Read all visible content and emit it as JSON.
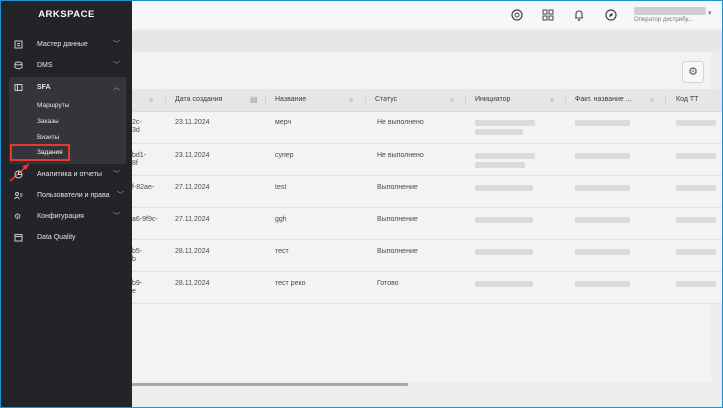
{
  "app": {
    "logo": "ARKSPACE"
  },
  "topbar": {
    "icons": [
      "support-icon",
      "apps-grid-icon",
      "bell-icon",
      "compass-icon"
    ],
    "user_role": "Оператор дистрибу..."
  },
  "sidebar": {
    "items": [
      {
        "label": "Мастер данные",
        "icon": "master-data-icon"
      },
      {
        "label": "DMS",
        "icon": "dms-icon"
      },
      {
        "label": "SFA",
        "icon": "sfa-icon"
      },
      {
        "label": "Аналитика и отчеты",
        "icon": "analytics-icon"
      },
      {
        "label": "Пользователи и права",
        "icon": "users-icon"
      },
      {
        "label": "Конфигурация",
        "icon": "config-icon"
      },
      {
        "label": "Data Quality",
        "icon": "data-quality-icon"
      }
    ],
    "sfa_sub": [
      "Маршруты",
      "Заказы",
      "Визиты",
      "Задания"
    ],
    "active_sub": "Задания"
  },
  "table": {
    "columns": [
      "Дата создания",
      "Название",
      "Статус",
      "Инициатор",
      "Факт. название ...",
      "Код ТТ"
    ],
    "rows": [
      {
        "id1": "2c-",
        "id2": "3d",
        "date": "23.11.2024",
        "name": "мерч",
        "status": "Не выполнено"
      },
      {
        "id1": "bd1-",
        "id2": "8f",
        "date": "23.11.2024",
        "name": "супер",
        "status": "Не выполнено"
      },
      {
        "id1": "f-82ae-",
        "id2": "",
        "date": "27.11.2024",
        "name": "test",
        "status": "Выполнение"
      },
      {
        "id1": "a6-9f9c-",
        "id2": "",
        "date": "27.11.2024",
        "name": "ggh",
        "status": "Выполнение"
      },
      {
        "id1": "b5-",
        "id2": "b",
        "date": "28.11.2024",
        "name": "тест",
        "status": "Выполнение"
      },
      {
        "id1": "b9-",
        "id2": "e",
        "date": "28.11.2024",
        "name": "тест реко",
        "status": "Готово"
      }
    ]
  },
  "colors": {
    "sidebar_bg": "#232428",
    "active_outline": "#e53935",
    "frame_border": "#1e90d6"
  }
}
